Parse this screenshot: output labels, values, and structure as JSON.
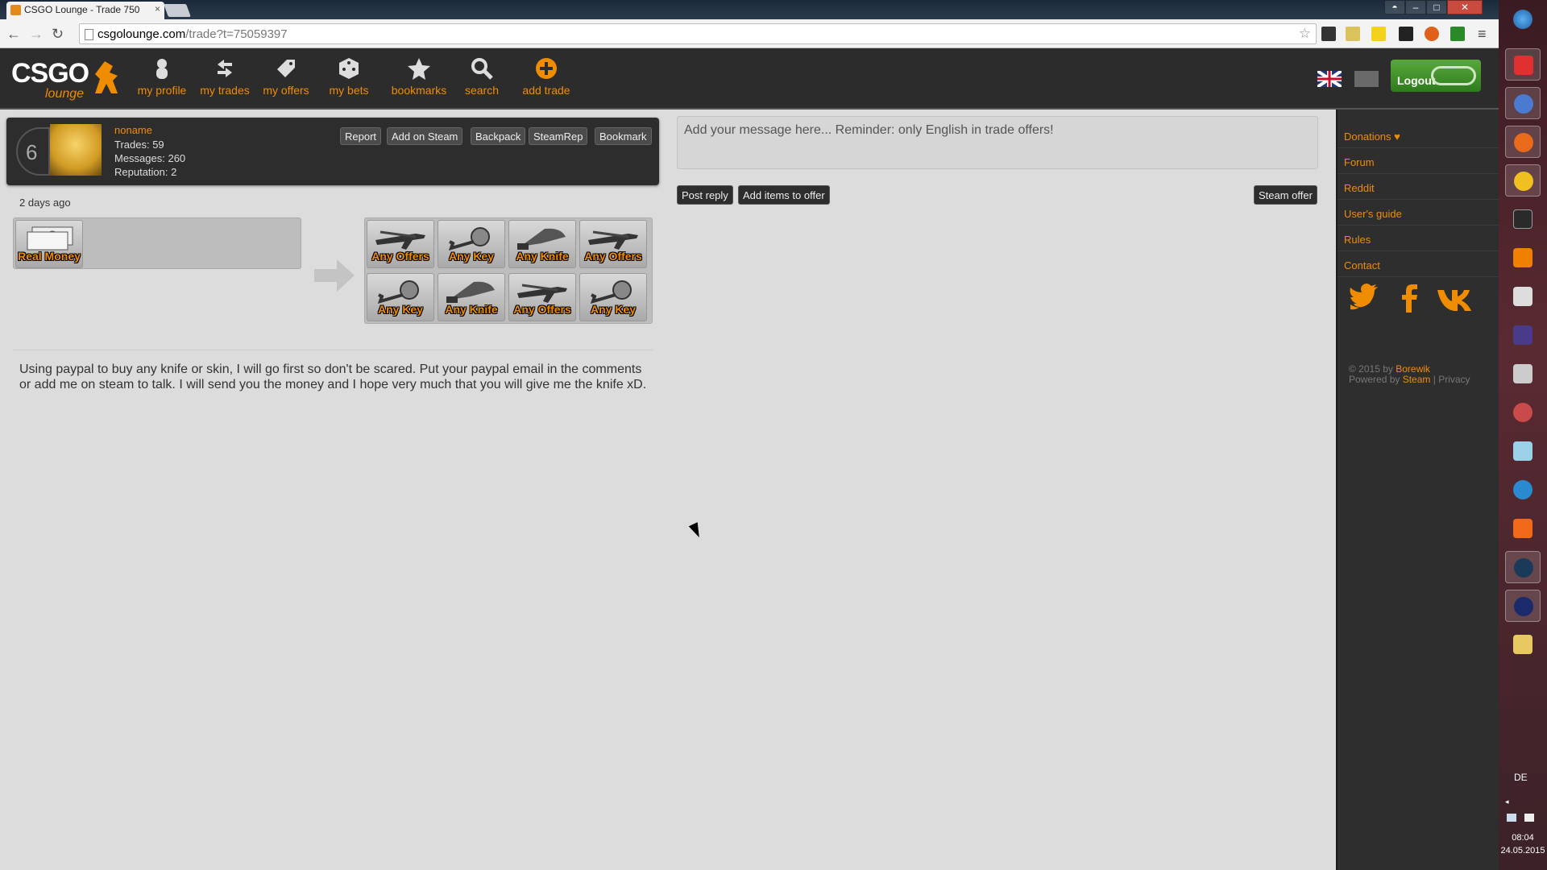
{
  "browser": {
    "tab_title": "CSGO Lounge - Trade 750",
    "tab_close": "×",
    "url_domain": "csgolounge.com",
    "url_path": "/trade?t=75059397",
    "star": "☆",
    "menu": "≡",
    "back": "←",
    "forward": "→",
    "reload": "↻",
    "win_min": "–",
    "win_max": "□",
    "win_close": "✕"
  },
  "site": {
    "logo_main": "CSGO",
    "logo_sub": "lounge",
    "nav": [
      {
        "label": "my profile",
        "icon": "profile-icon"
      },
      {
        "label": "my trades",
        "icon": "trades-icon"
      },
      {
        "label": "my offers",
        "icon": "tag-icon"
      },
      {
        "label": "my bets",
        "icon": "dice-icon"
      },
      {
        "label": "bookmarks",
        "icon": "star-icon"
      },
      {
        "label": "search",
        "icon": "magnifier-icon"
      },
      {
        "label": "add trade",
        "icon": "plus-circle-icon"
      }
    ],
    "logout": "Logout",
    "accent_color": "#f08c00"
  },
  "trade": {
    "rank": "6",
    "username": "noname",
    "trades": "Trades: 59",
    "messages": "Messages: 260",
    "reputation": "Reputation: 2",
    "buttons": [
      "Report",
      "Add on Steam",
      "Backpack",
      "SteamRep",
      "Bookmark"
    ],
    "posted": "2 days ago",
    "have": [
      {
        "label": "Real Money",
        "icon": "money-icon"
      }
    ],
    "want": [
      {
        "label": "Any Offers",
        "icon": "rifle-icon"
      },
      {
        "label": "Any Key",
        "icon": "key-icon"
      },
      {
        "label": "Any Knife",
        "icon": "knife-icon"
      },
      {
        "label": "Any Offers",
        "icon": "rifle-icon"
      },
      {
        "label": "Any Key",
        "icon": "key-icon"
      },
      {
        "label": "Any Knife",
        "icon": "knife-icon"
      },
      {
        "label": "Any Offers",
        "icon": "rifle-icon"
      },
      {
        "label": "Any Key",
        "icon": "key-icon"
      }
    ],
    "description": "Using paypal to buy any knife or skin, I will go first so don't be scared. Put your paypal email in the comments or add me on steam to talk. I will send you the money and I hope very much that you will give me the knife xD."
  },
  "reply": {
    "placeholder": "Add your message here... Reminder: only English in trade offers!",
    "post_reply": "Post reply",
    "add_items": "Add items to offer",
    "steam_offer": "Steam offer"
  },
  "sidebar": {
    "links": [
      "Donations ♥",
      "Forum",
      "Reddit",
      "User's guide",
      "Rules",
      "Contact"
    ],
    "social": [
      "twitter-icon",
      "facebook-icon",
      "vk-icon"
    ],
    "copyright_prefix": "© 2015 by",
    "copyright_author": "Borewik",
    "powered_prefix": "Powered by",
    "powered_steam": "Steam",
    "sep": "|",
    "privacy": "Privacy"
  },
  "taskbar": {
    "lang": "DE",
    "time": "08:04",
    "date": "24.05.2015"
  }
}
